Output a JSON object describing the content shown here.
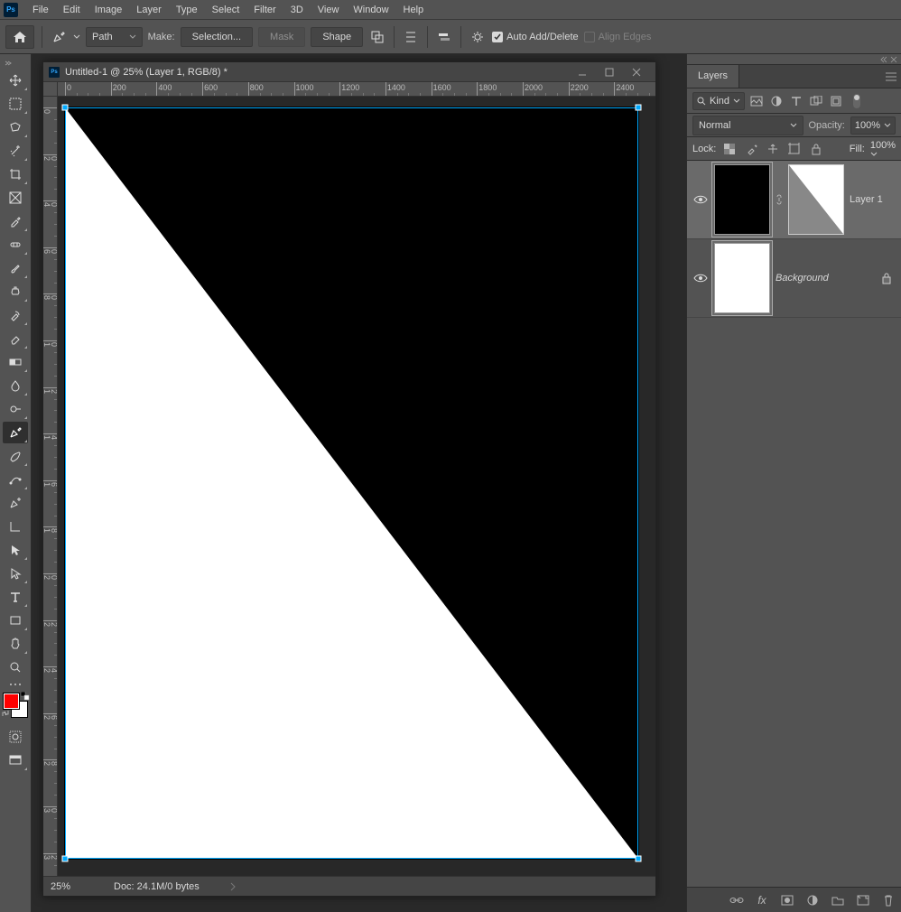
{
  "menu": {
    "items": [
      "File",
      "Edit",
      "Image",
      "Layer",
      "Type",
      "Select",
      "Filter",
      "3D",
      "View",
      "Window",
      "Help"
    ]
  },
  "optbar": {
    "mode": "Path",
    "make": "Make:",
    "selection": "Selection...",
    "mask": "Mask",
    "shape": "Shape",
    "auto": "Auto Add/Delete",
    "align": "Align Edges"
  },
  "doc": {
    "title": "Untitled-1 @ 25% (Layer 1, RGB/8) *",
    "zoom": "25%",
    "status": "Doc: 24.1M/0 bytes",
    "rulerH": [
      "0",
      "200",
      "400",
      "600",
      "800",
      "1000",
      "1200",
      "1400",
      "1600",
      "1800",
      "2000",
      "2200",
      "2400"
    ],
    "rulerV": [
      "0",
      "200",
      "400",
      "600",
      "800",
      "1000",
      "1200",
      "1400",
      "1600",
      "1800",
      "2000",
      "2200",
      "2400",
      "2600",
      "2800",
      "3000",
      "3200"
    ]
  },
  "layers": {
    "tab": "Layers",
    "kind": "Kind",
    "blend": "Normal",
    "opacity_l": "Opacity:",
    "opacity_v": "100%",
    "lock": "Lock:",
    "fill_l": "Fill:",
    "fill_v": "100%",
    "items": [
      {
        "name": "Layer 1"
      },
      {
        "name": "Background"
      }
    ]
  },
  "colors": {
    "fg": "#ff0000",
    "bg": "#ffffff",
    "path": "#00aaff"
  }
}
